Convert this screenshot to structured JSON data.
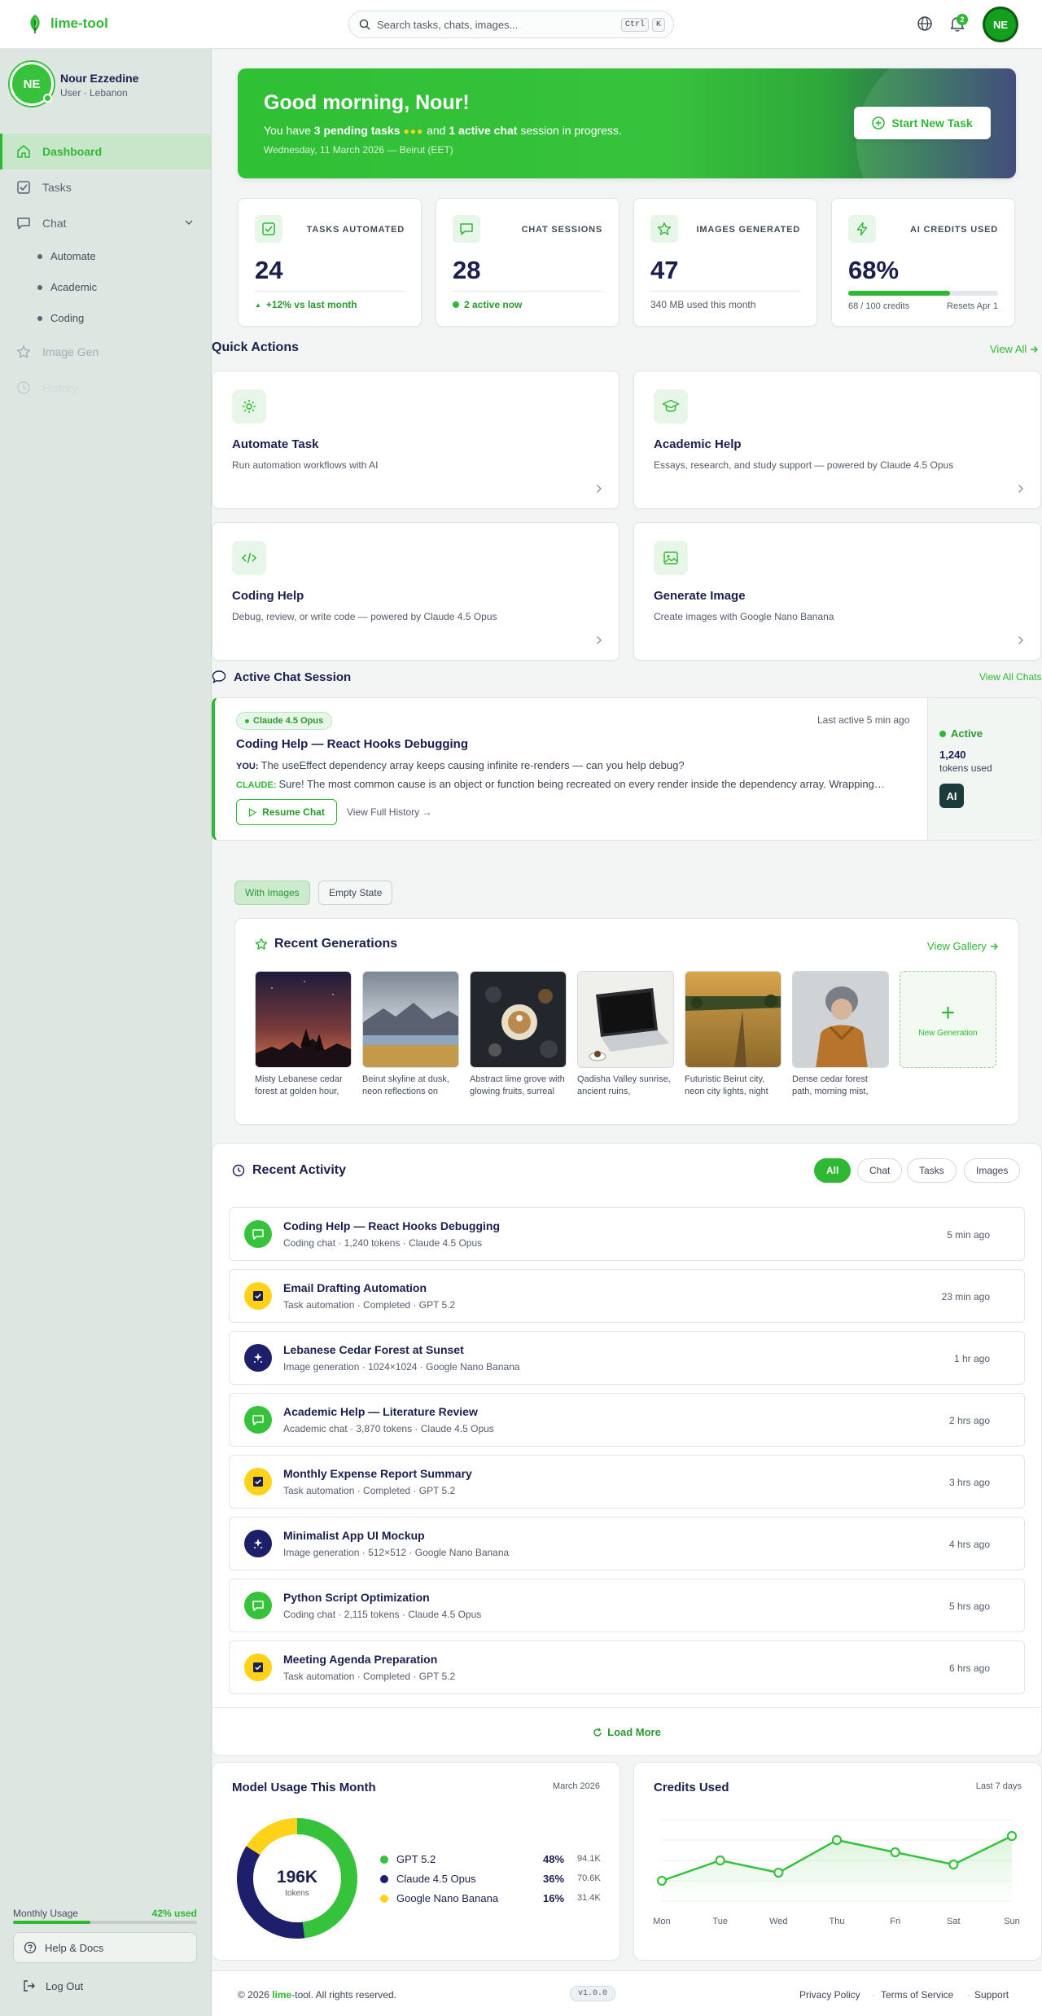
{
  "app": {
    "name": "lime-tool"
  },
  "search": {
    "placeholder": "Search tasks, chats, images...",
    "kbd_ctrl": "Ctrl",
    "kbd_k": "K"
  },
  "topbar": {
    "notification_count": "2",
    "avatar_initials": "NE"
  },
  "profile": {
    "initials": "NE",
    "name": "Nour Ezzedine",
    "role": "User · Lebanon"
  },
  "sidebar": {
    "items": [
      {
        "label": "Dashboard",
        "icon": "home-icon"
      },
      {
        "label": "Tasks",
        "icon": "check-square-icon"
      },
      {
        "label": "Chat",
        "icon": "chat-icon"
      },
      {
        "label": "Image Gen",
        "icon": "star-icon"
      },
      {
        "label": "History",
        "icon": "clock-icon"
      }
    ],
    "chat_sub": [
      "Automate",
      "Academic",
      "Coding"
    ],
    "usage_label": "Monthly Usage",
    "usage_value": "42% used",
    "usage_fraction": 0.42,
    "help_label": "Help & Docs",
    "logout_label": "Log Out"
  },
  "hero": {
    "greeting": "Good morning, Nour!",
    "sub_pre": "You have",
    "pending": "3 pending tasks",
    "dots": "●●●",
    "sub_mid": "and",
    "active": "1 active chat",
    "sub_post": "session in progress.",
    "date": "Wednesday, 11 March 2026 — Beirut (EET)",
    "button": "Start New Task"
  },
  "stats": [
    {
      "label": "TASKS AUTOMATED",
      "value": "24",
      "foot": "+12% vs last month"
    },
    {
      "label": "CHAT SESSIONS",
      "value": "28",
      "foot": "2 active now"
    },
    {
      "label": "IMAGES GENERATED",
      "value": "47",
      "foot": "340 MB used this month"
    },
    {
      "label": "AI CREDITS USED",
      "value": "68%",
      "credits": "68 / 100 credits",
      "resets": "Resets Apr 1",
      "fraction": 0.68
    }
  ],
  "quick_actions": {
    "title": "Quick Actions",
    "view_all": "View All",
    "items": [
      {
        "title": "Automate Task",
        "desc": "Run automation workflows with AI"
      },
      {
        "title": "Academic Help",
        "desc": "Essays, research, and study support — powered by Claude 4.5 Opus"
      },
      {
        "title": "Coding Help",
        "desc": "Debug, review, or write code — powered by Claude 4.5 Opus"
      },
      {
        "title": "Generate Image",
        "desc": "Create images with Google Nano Banana"
      }
    ]
  },
  "chat_session": {
    "title": "Active Chat Session",
    "view_all": "View All Chats",
    "model": "Claude 4.5 Opus",
    "session_title": "Coding Help — React Hooks Debugging",
    "last_active": "Last active 5 min ago",
    "you_label": "YOU:",
    "you_msg": "The useEffect dependency array keeps causing infinite re-renders — can you help debug?",
    "claude_label": "CLAUDE:",
    "claude_msg": "Sure! The most common cause is an object or function being recreated on every render inside the dependency array. Wrapping it in useMemo or useCallback usually fixes it.",
    "resume": "Resume Chat",
    "history": "View Full History →",
    "status": "Active",
    "tokens": "1,240",
    "tokens_label": "tokens used",
    "badge": "AI"
  },
  "view_toggle": {
    "with_images": "With Images",
    "empty_state": "Empty State"
  },
  "gallery": {
    "title": "Recent Generations",
    "view": "View Gallery",
    "items": [
      {
        "caption": "Misty Lebanese cedar forest at golden hour, cinematic"
      },
      {
        "caption": "Beirut skyline at dusk, neon reflections on water"
      },
      {
        "caption": "Abstract lime grove with glowing fruits, surreal style"
      },
      {
        "caption": "Qadisha Valley sunrise, ancient ruins, watercolor"
      },
      {
        "caption": "Futuristic Beirut city, neon city lights, night"
      },
      {
        "caption": "Dense cedar forest path, morning mist, moody"
      }
    ],
    "new_label": "New Generation",
    "new_plus": "+"
  },
  "activity": {
    "title": "Recent Activity",
    "filters": [
      "All",
      "Chat",
      "Tasks",
      "Images"
    ],
    "rows": [
      {
        "type": "chat",
        "title": "Coding Help — React Hooks Debugging",
        "sub": "Coding chat · 1,240 tokens · Claude 4.5 Opus",
        "time": "5 min ago"
      },
      {
        "type": "task",
        "title": "Email Drafting Automation",
        "sub": "Task automation · Completed · GPT 5.2",
        "time": "23 min ago"
      },
      {
        "type": "image",
        "title": "Lebanese Cedar Forest at Sunset",
        "sub": "Image generation · 1024×1024 · Google Nano Banana",
        "time": "1 hr ago"
      },
      {
        "type": "chat",
        "title": "Academic Help — Literature Review",
        "sub": "Academic chat · 3,870 tokens · Claude 4.5 Opus",
        "time": "2 hrs ago"
      },
      {
        "type": "task",
        "title": "Monthly Expense Report Summary",
        "sub": "Task automation · Completed · GPT 5.2",
        "time": "3 hrs ago"
      },
      {
        "type": "image",
        "title": "Minimalist App UI Mockup",
        "sub": "Image generation · 512×512 · Google Nano Banana",
        "time": "4 hrs ago"
      },
      {
        "type": "chat",
        "title": "Python Script Optimization",
        "sub": "Coding chat · 2,115 tokens · Claude 4.5 Opus",
        "time": "5 hrs ago"
      },
      {
        "type": "task",
        "title": "Meeting Agenda Preparation",
        "sub": "Task automation · Completed · GPT 5.2",
        "time": "6 hrs ago"
      }
    ],
    "load_more": "Load More"
  },
  "model_usage": {
    "title": "Model Usage This Month",
    "period": "March 2026",
    "total": "196K",
    "total_unit": "tokens"
  },
  "credits": {
    "title": "Credits Used",
    "period": "Last 7 days"
  },
  "chart_data": [
    {
      "type": "pie",
      "title": "Model Usage This Month",
      "categories": [
        "GPT 5.2",
        "Claude 4.5 Opus",
        "Google Nano Banana"
      ],
      "values": [
        48,
        36,
        16
      ],
      "labels": [
        "48%",
        "36%",
        "16%"
      ],
      "tokens": [
        "94.1K",
        "70.6K",
        "31.4K"
      ],
      "colors": [
        "#37c23c",
        "#1e1f6b",
        "#ffd21a"
      ],
      "center_value": "196K",
      "center_label": "tokens"
    },
    {
      "type": "line",
      "title": "Credits Used",
      "categories": [
        "Mon",
        "Tue",
        "Wed",
        "Thu",
        "Fri",
        "Sat",
        "Sun"
      ],
      "values": [
        5,
        10,
        7,
        15,
        12,
        9,
        16
      ],
      "ylim": [
        0,
        20
      ],
      "grid": true,
      "color": "#37c23c"
    }
  ],
  "footer": {
    "copy_pre": "© 2026",
    "copy_brand": "lime",
    "copy_post": "-tool. All rights reserved.",
    "version": "v1.0.0",
    "links": [
      "Privacy Policy",
      "Terms of Service",
      "Support"
    ]
  }
}
